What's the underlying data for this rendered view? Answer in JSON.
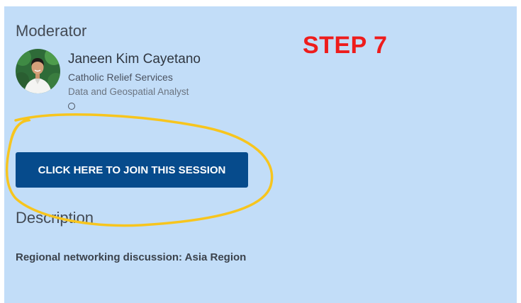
{
  "moderator": {
    "heading": "Moderator",
    "name": "Janeen Kim Cayetano",
    "organization": "Catholic Relief Services",
    "role": "Data and Geospatial Analyst"
  },
  "annotation": {
    "step_label": "STEP 7",
    "step_color": "#ee1c1c",
    "highlight_color": "#f7c51e"
  },
  "session": {
    "join_label": "CLICK HERE TO JOIN THIS SESSION",
    "button_color": "#064b8c"
  },
  "description": {
    "heading": "Description",
    "text": "Regional networking discussion: Asia Region"
  },
  "theme": {
    "panel_background": "#c2ddf8"
  }
}
